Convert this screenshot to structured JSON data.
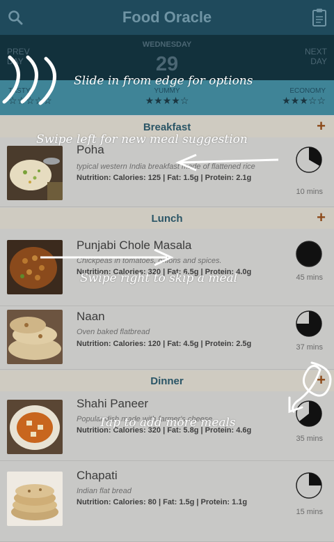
{
  "header": {
    "title": "Food Oracle",
    "left_icon": "search-icon",
    "right_icon": "clipboard-icon"
  },
  "day_nav": {
    "prev_line1": "PREV",
    "prev_line2": "DAY",
    "next_line1": "NEXT",
    "next_line2": "DAY",
    "day_name": "WEDNESDAY",
    "day_number": "29"
  },
  "ratings": {
    "left_label": "TASTY",
    "mid_label": "YUMMY",
    "right_label": "ECONOMY",
    "left_stars": "☆☆☆☆☆",
    "mid_stars": "★★★★☆",
    "right_stars": "★★★☆☆"
  },
  "sections": {
    "breakfast": {
      "title": "Breakfast"
    },
    "lunch": {
      "title": "Lunch"
    },
    "dinner": {
      "title": "Dinner"
    }
  },
  "meals": [
    {
      "name": "Poha",
      "desc": "typical western India breakfast made of flattened rice",
      "nutrition": "Nutrition: Calories: 125 | Fat: 1.5g | Protein: 2.1g",
      "mins": "10 mins"
    },
    {
      "name": "Punjabi Chole Masala",
      "desc": "Chickpeas in tomatoes, onions and spices.",
      "nutrition": "Nutrition: Calories: 320 | Fat: 6.5g | Protein: 4.0g",
      "mins": "45 mins"
    },
    {
      "name": "Naan",
      "desc": "Oven baked flatbread",
      "nutrition": "Nutrition: Calories: 120 | Fat: 4.5g | Protein: 2.5g",
      "mins": "37 mins"
    },
    {
      "name": "Shahi Paneer",
      "desc": "Popular dish made with farmer's cheese",
      "nutrition": "Nutrition: Calories: 320 | Fat: 5.8g | Protein: 4.6g",
      "mins": "35 mins"
    },
    {
      "name": "Chapati",
      "desc": "Indian flat bread",
      "nutrition": "Nutrition: Calories: 80 | Fat: 1.5g | Protein: 1.1g",
      "mins": "15 mins"
    }
  ],
  "hints": {
    "slide": "Slide in from edge for options",
    "swipe_left": "Swipe left for new meal suggestion",
    "swipe_right": "Swipe right to skip a meal",
    "tap_add": "Tap to add more meals"
  },
  "colors": {
    "header_bg": "#1f4a5c",
    "daynav_bg": "#12313c",
    "ratings_bg": "#3f8497",
    "accent_plus": "#8c4a1a",
    "overlay_text": "#ffffff"
  }
}
